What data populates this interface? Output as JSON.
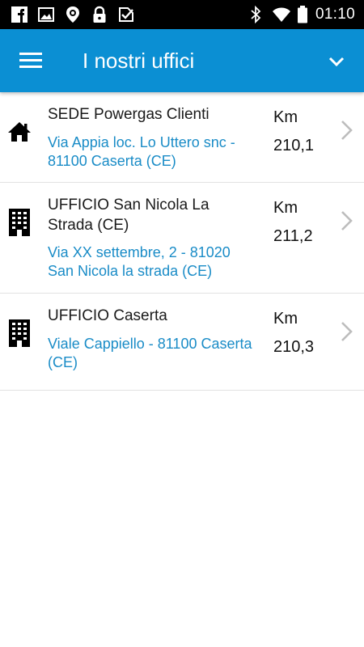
{
  "status_bar": {
    "time": "01:10",
    "left_icons": [
      "facebook-icon",
      "image-icon",
      "location-pin-icon",
      "lock-icon",
      "check-badge-icon"
    ],
    "right_icons": [
      "bluetooth-icon",
      "wifi-icon",
      "battery-icon"
    ]
  },
  "app_bar": {
    "title": "I nostri uffici",
    "menu_icon": "hamburger-menu-icon",
    "dropdown_icon": "chevron-down-icon",
    "color": "#0b8fd3"
  },
  "offices": [
    {
      "icon": "home-icon",
      "name": "SEDE Powergas Clienti",
      "address": "Via Appia loc. Lo Uttero snc - 81100 Caserta (CE)",
      "distance_unit": "Km",
      "distance": "210,1"
    },
    {
      "icon": "office-building-icon",
      "name": "UFFICIO San Nicola La Strada (CE)",
      "address": "Via XX settembre, 2 - 81020 San Nicola la strada (CE)",
      "distance_unit": "Km",
      "distance": "211,2"
    },
    {
      "icon": "office-building-icon",
      "name": "UFFICIO Caserta",
      "address": "Viale Cappiello - 81100 Caserta (CE)",
      "distance_unit": "Km",
      "distance": "210,3"
    }
  ],
  "colors": {
    "link": "#1a8cc7",
    "status_bar": "#000000"
  }
}
